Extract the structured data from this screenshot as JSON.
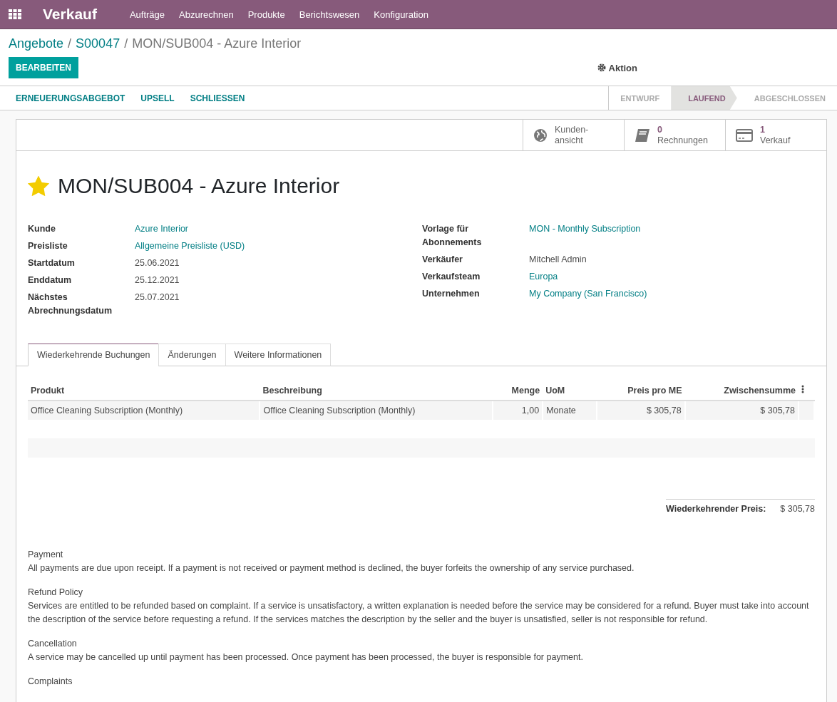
{
  "navbar": {
    "app_name": "Verkauf",
    "menu": [
      "Aufträge",
      "Abzurechnen",
      "Produkte",
      "Berichtswesen",
      "Konfiguration"
    ]
  },
  "breadcrumb_separator": "/",
  "breadcrumb": [
    {
      "label": "Angebote",
      "kind": "link"
    },
    {
      "label": "S00047",
      "kind": "link"
    },
    {
      "label": "MON/SUB004 - Azure Interior",
      "kind": "current"
    }
  ],
  "edit_button": "BEARBEITEN",
  "action_menu": "Aktion",
  "header_buttons": [
    "ERNEUERUNGSABGEBOT",
    "UPSELL",
    "SCHLIESSEN"
  ],
  "status_stages": [
    {
      "label": "ENTWURF",
      "selected": false
    },
    {
      "label": "LAUFEND",
      "selected": true
    },
    {
      "label": "ABGESCHLOSSEN",
      "selected": false
    }
  ],
  "stat_buttons": [
    {
      "kind": "portal",
      "line1": "Kunden-",
      "line2": "ansicht"
    },
    {
      "kind": "invoices",
      "line1": "0",
      "line2": "Rechnungen"
    },
    {
      "kind": "sales",
      "line1": "1",
      "line2": "Verkauf"
    }
  ],
  "favorite": true,
  "title": "MON/SUB004 - Azure Interior",
  "fields_left": [
    {
      "label": "Kunde",
      "value": "Azure Interior",
      "link": true
    },
    {
      "label": "Preisliste",
      "value": "Allgemeine Preisliste (USD)",
      "link": true
    },
    {
      "label": "Startdatum",
      "value": "25.06.2021",
      "link": false
    },
    {
      "label": "Enddatum",
      "value": "25.12.2021",
      "link": false
    },
    {
      "label": "Nächstes Abrechnungsdatum",
      "value": "25.07.2021",
      "link": false
    }
  ],
  "fields_right": [
    {
      "label": "Vorlage für Abonnements",
      "value": "MON - Monthly Subscription",
      "link": true
    },
    {
      "label": "Verkäufer",
      "value": "Mitchell Admin",
      "link": false
    },
    {
      "label": "Verkaufsteam",
      "value": "Europa",
      "link": true
    },
    {
      "label": "Unternehmen",
      "value": "My Company (San Francisco)",
      "link": true
    }
  ],
  "tabs": [
    {
      "label": "Wiederkehrende Buchungen",
      "selected": true
    },
    {
      "label": "Änderungen",
      "selected": false
    },
    {
      "label": "Weitere Informationen",
      "selected": false
    }
  ],
  "table": {
    "columns": [
      {
        "label": "Produkt",
        "kind": "text"
      },
      {
        "label": "Beschreibung",
        "kind": "text"
      },
      {
        "label": "Menge",
        "kind": "number"
      },
      {
        "label": "UoM",
        "kind": "text"
      },
      {
        "label": "Preis pro ME",
        "kind": "number"
      },
      {
        "label": "Zwischensumme",
        "kind": "number"
      }
    ],
    "rows": [
      [
        "Office Cleaning Subscription (Monthly)",
        "Office Cleaning Subscription (Monthly)",
        "1,00",
        "Monate",
        "$ 305,78",
        "$ 305,78"
      ]
    ]
  },
  "total": {
    "label": "Wiederkehrender Preis:",
    "value": "$ 305,78"
  },
  "terms": [
    {
      "heading": "Payment",
      "text": "All payments are due upon receipt. If a payment is not received or payment method is declined, the buyer forfeits the ownership of any service purchased."
    },
    {
      "heading": "Refund Policy",
      "text": "Services are entitled to be refunded based on complaint. If a service is unsatisfactory, a written explanation is needed before the service may be considered for a refund. Buyer must take into account the description of the service before requesting a refund. If the services matches the description by the seller and the buyer is unsatisfied, seller is not responsible for refund."
    },
    {
      "heading": "Cancellation",
      "text": "A service may be cancelled up until payment has been processed. Once payment has been processed, the buyer is responsible for payment."
    },
    {
      "heading": "Complaints"
    }
  ]
}
